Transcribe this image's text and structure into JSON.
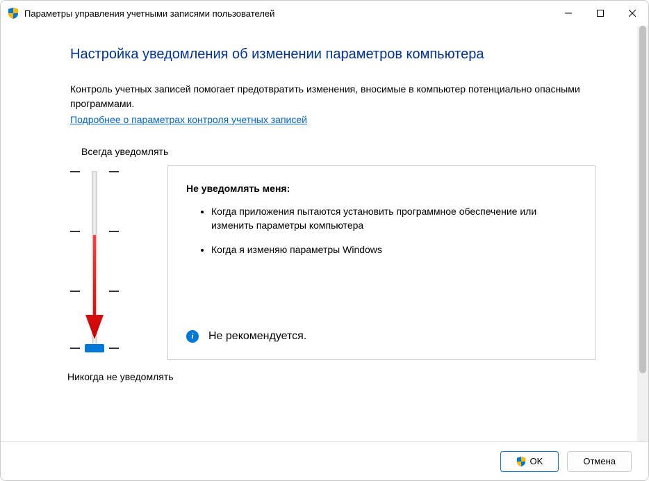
{
  "window": {
    "title": "Параметры управления учетными записями пользователей"
  },
  "heading": "Настройка уведомления об изменении параметров компьютера",
  "description": "Контроль учетных записей помогает предотвратить изменения, вносимые в компьютер потенциально опасными программами.",
  "link_text": "Подробнее о параметрах контроля учетных записей",
  "slider": {
    "top_label": "Всегда уведомлять",
    "bottom_label": "Никогда не уведомлять"
  },
  "info": {
    "title": "Не уведомлять меня:",
    "items": [
      "Когда приложения пытаются установить программное обеспечение или изменить параметры компьютера",
      "Когда я изменяю параметры Windows"
    ],
    "footer_text": "Не рекомендуется."
  },
  "buttons": {
    "ok": "OK",
    "cancel": "Отмена"
  }
}
